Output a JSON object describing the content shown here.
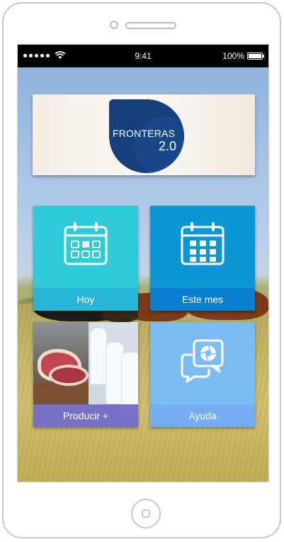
{
  "status_bar": {
    "time": "9:41",
    "battery": "100%"
  },
  "logo": {
    "title": "FRONTERAS",
    "version": "2.0"
  },
  "tiles": [
    {
      "label": "Hoy",
      "icon": "calendar-day-icon",
      "color": "#2ecad9"
    },
    {
      "label": "Este mes",
      "icon": "calendar-month-icon",
      "color": "#0b96d6"
    },
    {
      "label": "Producir +",
      "icon": "meat-milk-photo",
      "color": "#7671c6"
    },
    {
      "label": "Ayuda",
      "icon": "help-chat-icon",
      "color": "#7bbcf5"
    }
  ]
}
